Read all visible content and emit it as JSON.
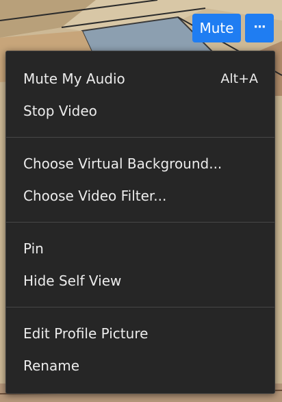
{
  "video_controls": {
    "mute_label": "Mute",
    "more_icon": "ellipsis-icon",
    "more_glyph": "···"
  },
  "colors": {
    "accent": "#1f7df2",
    "menu_background": "#262626",
    "menu_text": "#ececec",
    "separator": "#474747"
  },
  "menu": {
    "groups": [
      {
        "items": [
          {
            "label": "Mute My Audio",
            "shortcut": "Alt+A"
          },
          {
            "label": "Stop Video"
          }
        ]
      },
      {
        "items": [
          {
            "label": "Choose Virtual Background..."
          },
          {
            "label": "Choose Video Filter..."
          }
        ]
      },
      {
        "items": [
          {
            "label": "Pin"
          },
          {
            "label": "Hide Self View"
          }
        ]
      },
      {
        "items": [
          {
            "label": "Edit Profile Picture"
          },
          {
            "label": "Rename"
          }
        ]
      }
    ]
  }
}
